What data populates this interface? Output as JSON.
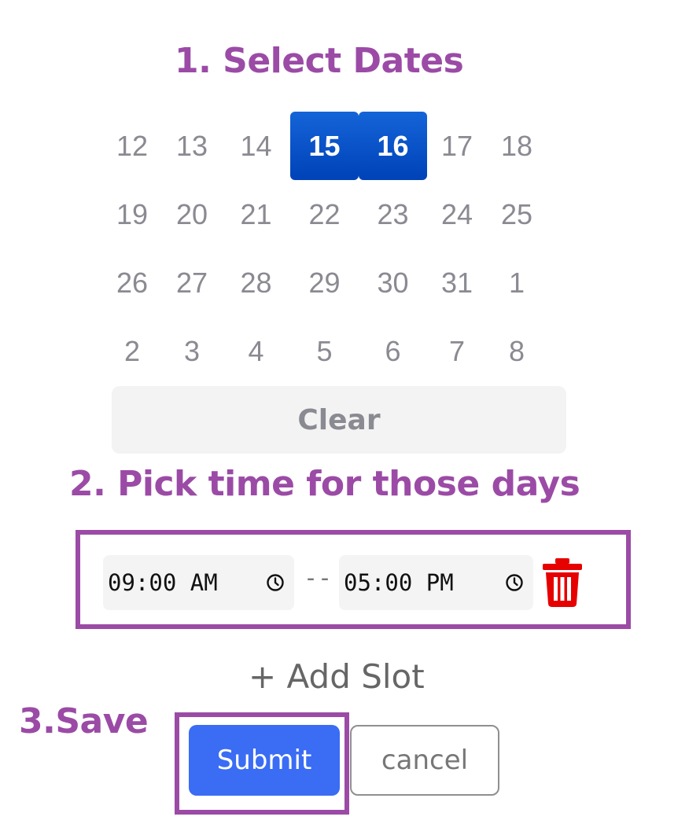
{
  "steps": {
    "step1": "1. Select Dates",
    "step2": "2. Pick time for those days",
    "step3": "3.Save"
  },
  "calendar": {
    "rows": [
      [
        "12",
        "13",
        "14",
        "15",
        "16",
        "17",
        "18"
      ],
      [
        "19",
        "20",
        "21",
        "22",
        "23",
        "24",
        "25"
      ],
      [
        "26",
        "27",
        "28",
        "29",
        "30",
        "31",
        "1"
      ],
      [
        "2",
        "3",
        "4",
        "5",
        "6",
        "7",
        "8"
      ]
    ],
    "selected": [
      "15",
      "16"
    ]
  },
  "clear_label": "Clear",
  "slot": {
    "start": "09:00 AM",
    "separator": "--",
    "end": "05:00 PM"
  },
  "add_slot_label": "+ Add Slot",
  "submit_label": "Submit",
  "cancel_label": "cancel",
  "colors": {
    "annotation": "#9b4ba6",
    "selected_day": "#0042b8",
    "submit": "#3a6cf4",
    "trash": "#e60000"
  },
  "icons": {
    "clock": "clock-icon",
    "trash": "trash-icon"
  }
}
